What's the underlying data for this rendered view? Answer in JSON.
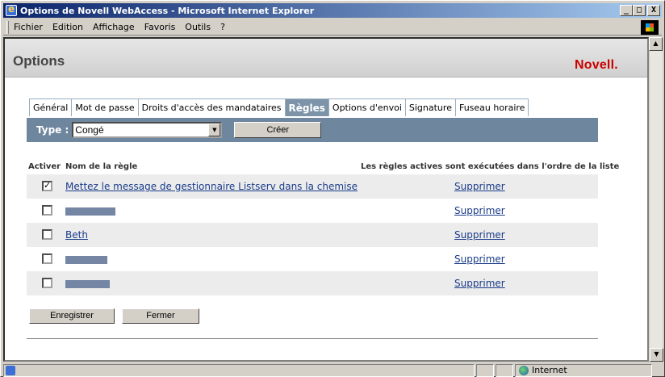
{
  "window": {
    "title": "Options de Novell WebAccess - Microsoft Internet Explorer",
    "buttons": {
      "minimize": "_",
      "maximize": "□",
      "close": "X"
    }
  },
  "menu": [
    {
      "label": "Fichier"
    },
    {
      "label": "Edition"
    },
    {
      "label": "Affichage"
    },
    {
      "label": "Favoris"
    },
    {
      "label": "Outils"
    },
    {
      "label": "?"
    }
  ],
  "header": {
    "title": "Options",
    "logo": "Novell."
  },
  "tabs": [
    {
      "label": "Général",
      "active": false
    },
    {
      "label": "Mot de passe",
      "active": false
    },
    {
      "label": "Droits d'accès des mandataires",
      "active": false
    },
    {
      "label": "Règles",
      "active": true
    },
    {
      "label": "Options d'envoi",
      "active": false
    },
    {
      "label": "Signature",
      "active": false
    },
    {
      "label": "Fuseau horaire",
      "active": false
    }
  ],
  "typebar": {
    "label": "Type :",
    "selected": "Congé",
    "create_label": "Créer"
  },
  "table": {
    "col_activer": "Activer",
    "col_nom": "Nom de la règle",
    "note": "Les règles actives sont exécutées dans l'ordre de la liste",
    "rows": [
      {
        "checked": true,
        "name": "Mettez le message de gestionnaire Listserv dans la chemise",
        "delete": "Supprimer",
        "redacted": false
      },
      {
        "checked": false,
        "name": "",
        "delete": "Supprimer",
        "redacted": true
      },
      {
        "checked": false,
        "name": "Beth",
        "delete": "Supprimer",
        "redacted": false
      },
      {
        "checked": false,
        "name": "",
        "delete": "Supprimer",
        "redacted": true
      },
      {
        "checked": false,
        "name": "",
        "delete": "Supprimer",
        "redacted": true
      }
    ]
  },
  "actions": {
    "save_label": "Enregistrer",
    "close_label": "Fermer"
  },
  "status": {
    "zone": "Internet"
  }
}
